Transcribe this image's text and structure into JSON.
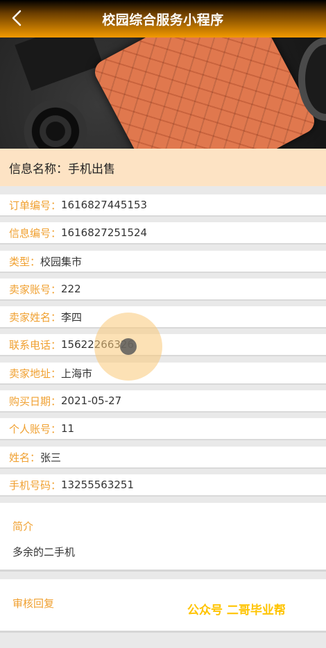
{
  "header": {
    "title": "校园综合服务小程序"
  },
  "info": {
    "label": "信息名称：",
    "value": "手机出售"
  },
  "fields": [
    {
      "label": "订单编号：",
      "value": "1616827445153"
    },
    {
      "label": "信息编号：",
      "value": "1616827251524"
    },
    {
      "label": "类型：",
      "value": "校园集市"
    },
    {
      "label": "卖家账号：",
      "value": "222"
    },
    {
      "label": "卖家姓名：",
      "value": "李四"
    },
    {
      "label": "联系电话：",
      "value": "15622266326"
    },
    {
      "label": "卖家地址：",
      "value": "上海市"
    },
    {
      "label": "购买日期：",
      "value": "2021-05-27"
    },
    {
      "label": "个人账号：",
      "value": "11"
    },
    {
      "label": "姓名：",
      "value": "张三"
    },
    {
      "label": "手机号码：",
      "value": "13255563251"
    }
  ],
  "intro": {
    "heading": "简介",
    "text": "多余的二手机"
  },
  "review": {
    "heading": "审核回复"
  },
  "watermark": "公众号 二哥毕业帮",
  "colors": {
    "accent": "#f0a030",
    "header_bottom": "#f39a00",
    "info_bg": "#fde3c4"
  }
}
